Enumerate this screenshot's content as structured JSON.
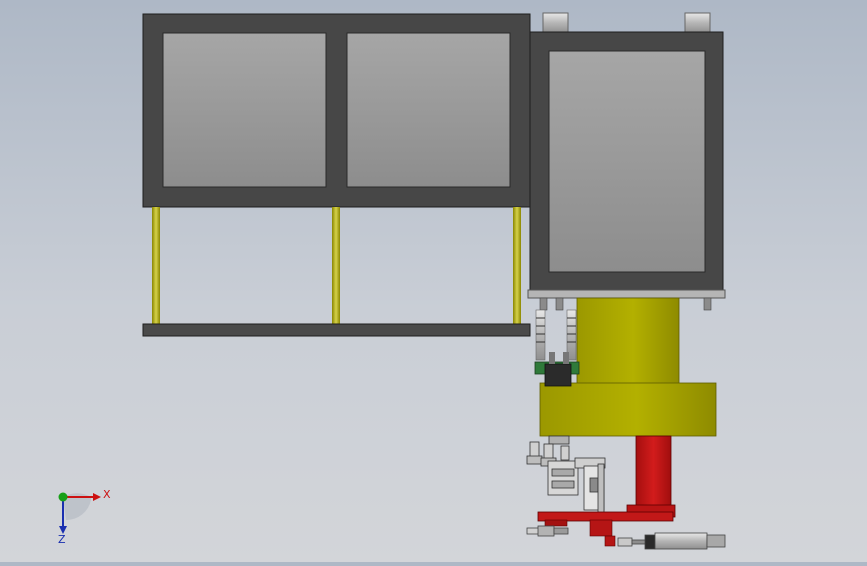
{
  "viewport": {
    "background_top": "#aeb8c6",
    "background_bottom": "#d3d5d9"
  },
  "triad": {
    "x_label": "X",
    "z_label": "Z",
    "x_color": "#cc1111",
    "z_color": "#1a2fb0",
    "y_color": "#18a018"
  },
  "colors": {
    "frame": "#474747",
    "panel": "#999999",
    "post": "#b5b100",
    "cylinder": "#a5a200",
    "red_part": "#c01515",
    "silver": "#c4c4c4"
  },
  "icons": [
    "coordinate-triad-icon"
  ]
}
